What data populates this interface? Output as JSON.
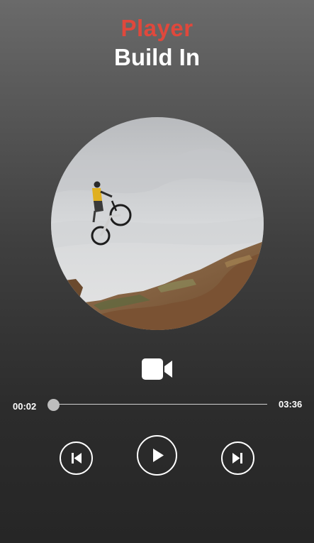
{
  "header": {
    "accent_title": "Player",
    "title": "Build In",
    "accent_color": "#e0483c"
  },
  "artwork": {
    "description_icon": "bmx-rider-jump-artwork"
  },
  "video_toggle": {
    "icon": "video-camera-icon"
  },
  "playback": {
    "current_time": "00:02",
    "total_time": "03:36",
    "progress_fraction": 0.01
  },
  "controls": {
    "previous_icon": "skip-previous-icon",
    "play_icon": "play-icon",
    "next_icon": "skip-next-icon"
  }
}
